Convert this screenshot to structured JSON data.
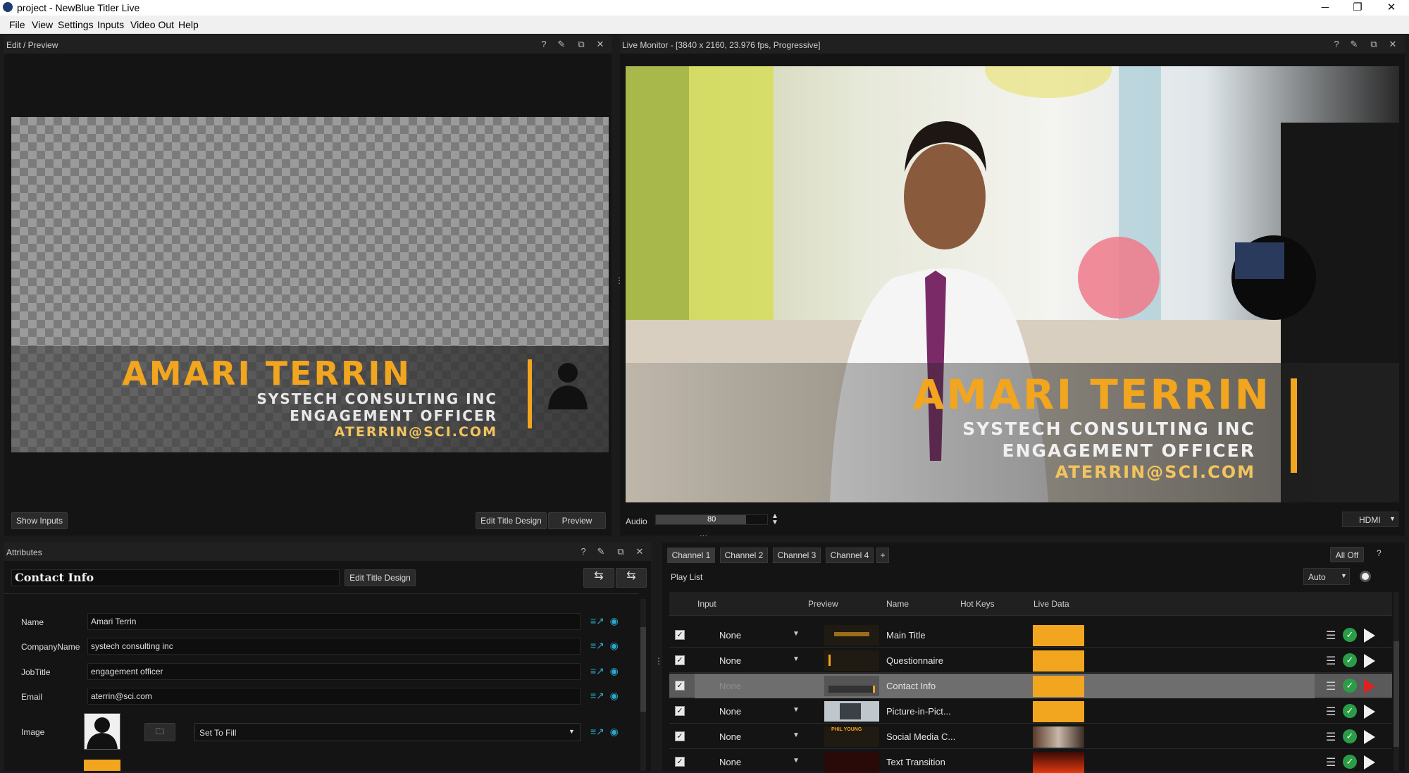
{
  "window": {
    "title": "project - NewBlue Titler Live"
  },
  "menu": [
    "File",
    "View",
    "Settings",
    "Inputs",
    "Video Out",
    "Help"
  ],
  "edit_preview": {
    "title": "Edit / Preview",
    "show_inputs": "Show Inputs",
    "edit_title_design": "Edit Title Design",
    "preview": "Preview"
  },
  "live_monitor": {
    "title": "Live Monitor - [3840 x 2160, 23.976 fps, Progressive]",
    "audio_label": "Audio",
    "audio_value": "80",
    "output": "HDMI"
  },
  "lower_third": {
    "name": "AMARI TERRIN",
    "company": "SYSTECH CONSULTING INC",
    "job": "ENGAGEMENT OFFICER",
    "email": "ATERRIN@SCI.COM"
  },
  "attributes": {
    "title": "Attributes",
    "title_name": "Contact Info",
    "edit_title_design": "Edit Title Design",
    "fields": [
      {
        "label": "Name",
        "value": "Amari Terrin"
      },
      {
        "label": "CompanyName",
        "value": "systech consulting inc"
      },
      {
        "label": "JobTitle",
        "value": "engagement officer"
      },
      {
        "label": "Email",
        "value": "aterrin@sci.com"
      }
    ],
    "image_label": "Image",
    "image_mode": "Set To Fill"
  },
  "channels": {
    "tabs": [
      "Channel 1",
      "Channel 2",
      "Channel 3",
      "Channel 4"
    ],
    "add": "+",
    "all_off": "All Off",
    "help": "?",
    "playlist_label": "Play List",
    "mode": "Auto",
    "columns": [
      "Input",
      "Preview",
      "Name",
      "Hot Keys",
      "Live Data"
    ],
    "rows": [
      {
        "input": "None",
        "name": "Main Title"
      },
      {
        "input": "None",
        "name": "Questionnaire"
      },
      {
        "input": "None",
        "name": "Contact Info"
      },
      {
        "input": "None",
        "name": "Picture-in-Pict..."
      },
      {
        "input": "None",
        "name": "Social Media C..."
      },
      {
        "input": "None",
        "name": "Text Transition"
      }
    ],
    "thumb_texts": {
      "pip": "PHIL YOUNG"
    }
  },
  "colors": {
    "accent": "#f2a51e",
    "bg": "#141414",
    "ok": "#2a9d46",
    "live_play": "#e02020"
  }
}
